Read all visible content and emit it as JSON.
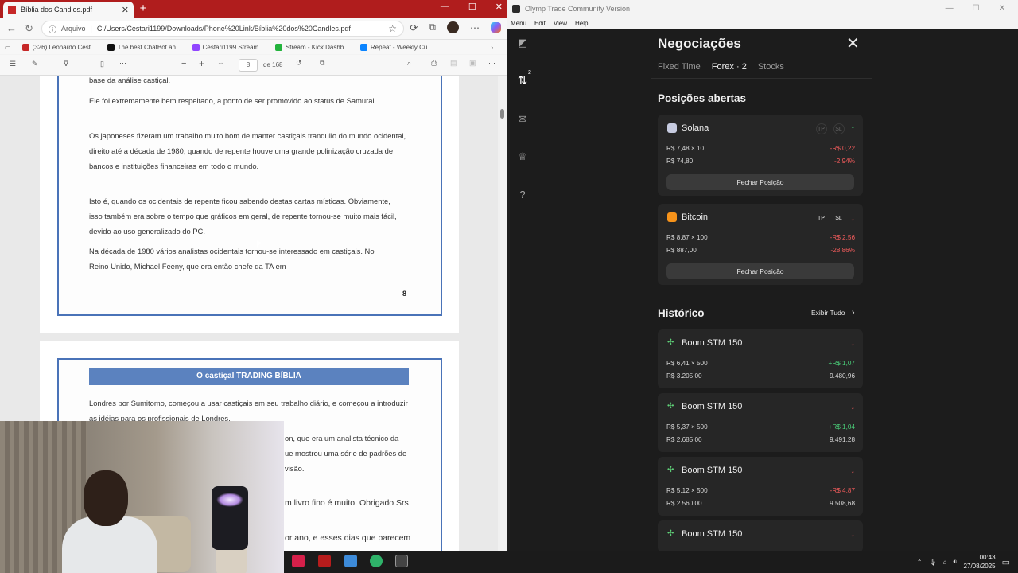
{
  "browser": {
    "tab_title": "Bíblia dos Candles.pdf",
    "url_label": "Arquivo",
    "url": "C:/Users/Cestari1199/Downloads/Phone%20Link/Bíblia%20dos%20Candles.pdf",
    "bookmarks": [
      {
        "label": "(326) Leonardo Cest...",
        "color": "#c62828"
      },
      {
        "label": "The best ChatBot an...",
        "color": "#111111"
      },
      {
        "label": "Cestari1199 Stream...",
        "color": "#9146ff"
      },
      {
        "label": "Stream - Kick Dashb...",
        "color": "#23b33c"
      },
      {
        "label": "Repeat - Weekly Cu...",
        "color": "#0a84ff"
      }
    ],
    "pdf": {
      "current_page": "8",
      "total_pages": "de 168",
      "page1_lines": [
        "base da análise castiçal.",
        "Ele foi extremamente bem respeitado, a ponto de ser promovido ao status de Samurai.",
        "Os japoneses fizeram um trabalho muito bom de manter castiçais tranquilo do mundo ocidental,",
        "direito até a década de 1980, quando de repente houve uma grande polinização cruzada de",
        "bancos e instituições financeiras em todo o mundo.",
        "Isto é, quando os ocidentais de repente ficou sabendo destas cartas místicas. Obviamente,",
        "isso também era sobre o tempo que gráficos em geral, de repente tornou-se muito mais fácil,",
        "devido ao uso generalizado do PC.",
        "Na década de 1980 vários analistas ocidentais tornou-se interessado em castiçais. No",
        "Reino Unido, Michael Feeny, que era então chefe da TA em"
      ],
      "page1_number": "8",
      "page2_header": "O castiçal TRADING BÍBLIA",
      "page2_lines": [
        "Londres por Sumitomo, começou a usar castiçais em seu trabalho diário, e começou a introduzir",
        "as idéias para os profissionais de Londres.",
        "on, que era um analista técnico da",
        "ue mostrou uma série de padrões de",
        "visão.",
        "m livro fino é muito. Obrigado Srs",
        "or ano, e esses dias que parecem"
      ]
    }
  },
  "olymp": {
    "window_title": "Olymp Trade Community Version",
    "menu": [
      "Menu",
      "Edit",
      "View",
      "Help"
    ],
    "panel_title": "Negociações",
    "tabs": [
      "Fixed Time",
      "Forex · 2",
      "Stocks"
    ],
    "open_positions_title": "Posições abertas",
    "positions": [
      {
        "asset": "Solana",
        "icon_color": "#c6cbe0",
        "tp": "TP",
        "sl": "SL",
        "direction": "up",
        "rate": "R$ 7,48 × 10",
        "pl": "-R$ 0,22",
        "amount": "R$ 74,80",
        "pct": "-2,94%",
        "button": "Fechar Posição"
      },
      {
        "asset": "Bitcoin",
        "icon_color": "#f7931a",
        "tp": "TP",
        "sl": "SL",
        "direction": "down",
        "rate": "R$ 8,87 × 100",
        "pl": "-R$ 2,56",
        "amount": "R$ 887,00",
        "pct": "-28,86%",
        "button": "Fechar Posição"
      }
    ],
    "history_title": "Histórico",
    "history_link": "Exibir Tudo",
    "history": [
      {
        "asset": "Boom STM 150",
        "rate": "R$ 6,41 × 500",
        "pl": "+R$ 1,07",
        "amount": "R$ 3.205,00",
        "close": "9.480,96",
        "pl_color": "green"
      },
      {
        "asset": "Boom STM 150",
        "rate": "R$ 5,37 × 500",
        "pl": "+R$ 1,04",
        "amount": "R$ 2.685,00",
        "close": "9.491,28",
        "pl_color": "green"
      },
      {
        "asset": "Boom STM 150",
        "rate": "R$ 5,12 × 500",
        "pl": "-R$ 4,87",
        "amount": "R$ 2.560,00",
        "close": "9.508,68",
        "pl_color": "red"
      },
      {
        "asset": "Boom STM 150",
        "rate": "",
        "pl": "",
        "amount": "",
        "close": "",
        "pl_color": "red"
      }
    ]
  },
  "taskbar": {
    "time": "00:43",
    "date": "27/08/2025"
  }
}
